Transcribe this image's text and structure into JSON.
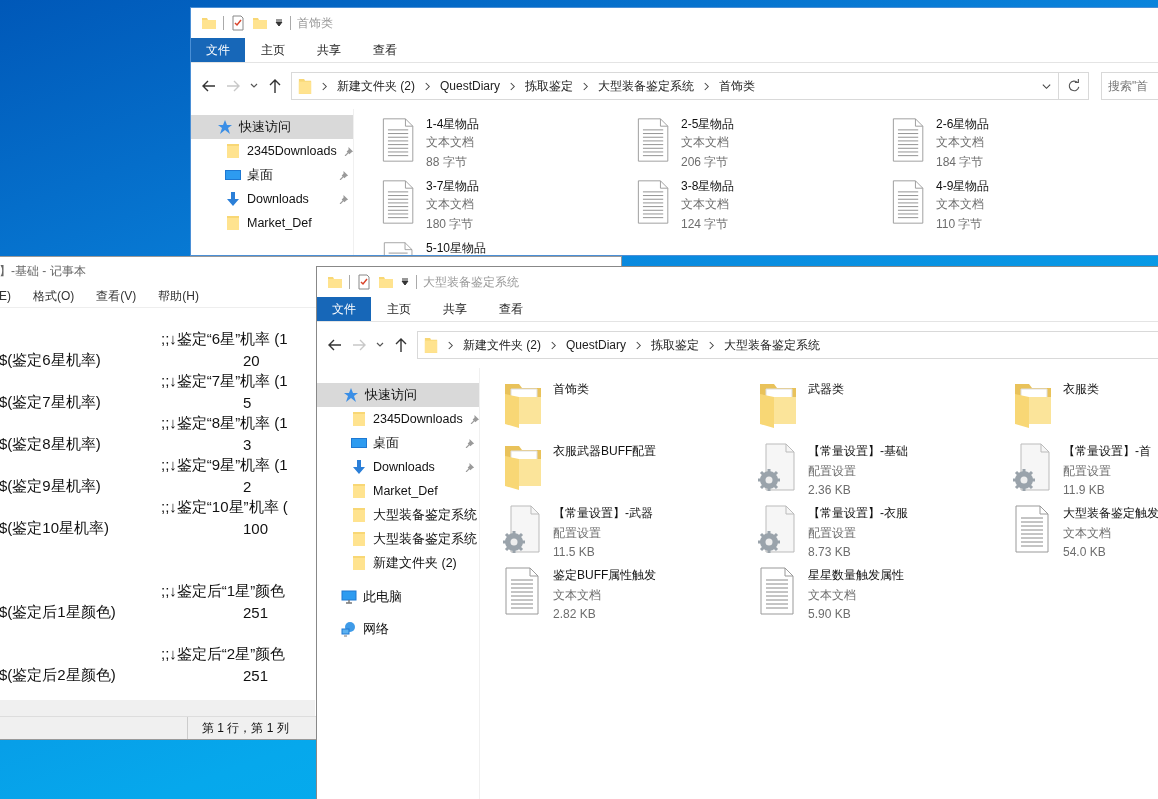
{
  "back_explorer": {
    "title": "首饰类",
    "ribbon_tabs": [
      {
        "label": "文件",
        "selected": true
      },
      {
        "label": "主页",
        "selected": false
      },
      {
        "label": "共享",
        "selected": false
      },
      {
        "label": "查看",
        "selected": false
      }
    ],
    "forward_disabled": true,
    "path": [
      "新建文件夹 (2)",
      "QuestDiary",
      "拣取鉴定",
      "大型装备鉴定系统",
      "首饰类"
    ],
    "search": {
      "placeholder": "搜索\"首"
    },
    "sidebar": [
      {
        "label": "快速访问",
        "kind": "quick",
        "selected": true,
        "pinned": false
      },
      {
        "label": "2345Downloads",
        "kind": "folder",
        "selected": false,
        "pinned": true
      },
      {
        "label": "桌面",
        "kind": "desktop",
        "selected": false,
        "pinned": true
      },
      {
        "label": "Downloads",
        "kind": "download",
        "selected": false,
        "pinned": true
      },
      {
        "label": "Market_Def",
        "kind": "folder",
        "selected": false,
        "pinned": false
      }
    ],
    "items": [
      {
        "name": "1-4星物品",
        "kind": "text",
        "type": "文本文档",
        "size": "88 字节"
      },
      {
        "name": "2-5星物品",
        "kind": "text",
        "type": "文本文档",
        "size": "206 字节"
      },
      {
        "name": "2-6星物品",
        "kind": "text",
        "type": "文本文档",
        "size": "184 字节"
      },
      {
        "name": "3-7星物品",
        "kind": "text",
        "type": "文本文档",
        "size": "180 字节"
      },
      {
        "name": "3-8星物品",
        "kind": "text",
        "type": "文本文档",
        "size": "124 字节"
      },
      {
        "name": "4-9星物品",
        "kind": "text",
        "type": "文本文档",
        "size": "110 字节"
      },
      {
        "name": "5-10星物品",
        "kind": "text"
      }
    ]
  },
  "notepad": {
    "title": "】-基础 - 记事本",
    "menu": [
      "E)",
      "格式(O)",
      "查看(V)",
      "帮助(H)"
    ],
    "lines": [
      {
        "kind": "comment",
        "text": ";;↓鉴定“6星”机率 (1"
      },
      {
        "kind": "value",
        "name": "$(鉴定6星机率)",
        "value": "20"
      },
      {
        "kind": "comment",
        "text": ";;↓鉴定“7星”机率 (1"
      },
      {
        "kind": "value",
        "name": "$(鉴定7星机率)",
        "value": "5"
      },
      {
        "kind": "comment",
        "text": ";;↓鉴定“8星”机率 (1"
      },
      {
        "kind": "value",
        "name": "$(鉴定8星机率)",
        "value": "3"
      },
      {
        "kind": "comment",
        "text": ";;↓鉴定“9星”机率 (1"
      },
      {
        "kind": "value",
        "name": "$(鉴定9星机率)",
        "value": "2"
      },
      {
        "kind": "comment",
        "text": ";;↓鉴定“10星”机率 ("
      },
      {
        "kind": "value",
        "name": "$(鉴定10星机率)",
        "value": "100"
      },
      {
        "kind": "blank"
      },
      {
        "kind": "blank"
      },
      {
        "kind": "comment",
        "text": ";;↓鉴定后“1星”颜色"
      },
      {
        "kind": "value",
        "name": "$(鉴定后1星颜色)",
        "value": "251"
      },
      {
        "kind": "blank"
      },
      {
        "kind": "comment",
        "text": ";;↓鉴定后“2星”颜色"
      },
      {
        "kind": "value",
        "name": "$(鉴定后2星颜色)",
        "value": "251"
      }
    ],
    "status": "第 1 行，第 1 列"
  },
  "front_explorer": {
    "title": "大型装备鉴定系统",
    "ribbon_tabs": [
      {
        "label": "文件",
        "selected": true
      },
      {
        "label": "主页",
        "selected": false
      },
      {
        "label": "共享",
        "selected": false
      },
      {
        "label": "查看",
        "selected": false
      }
    ],
    "forward_disabled": true,
    "path": [
      "新建文件夹 (2)",
      "QuestDiary",
      "拣取鉴定",
      "大型装备鉴定系统"
    ],
    "sidebar": [
      {
        "label": "快速访问",
        "kind": "quick",
        "selected": true,
        "pinned": false
      },
      {
        "label": "2345Downloads",
        "kind": "folder",
        "selected": false,
        "pinned": true
      },
      {
        "label": "桌面",
        "kind": "desktop",
        "selected": false,
        "pinned": true
      },
      {
        "label": "Downloads",
        "kind": "download",
        "selected": false,
        "pinned": true
      },
      {
        "label": "Market_Def",
        "kind": "folder",
        "selected": false,
        "pinned": false
      },
      {
        "label": "大型装备鉴定系统",
        "kind": "folder",
        "selected": false,
        "pinned": false
      },
      {
        "label": "大型装备鉴定系统",
        "kind": "folder",
        "selected": false,
        "pinned": false
      },
      {
        "label": "新建文件夹 (2)",
        "kind": "folder",
        "selected": false,
        "pinned": false
      },
      {
        "label": "此电脑",
        "kind": "pc",
        "selected": false,
        "pinned": false
      },
      {
        "label": "网络",
        "kind": "network",
        "selected": false,
        "pinned": false
      }
    ],
    "items": [
      {
        "name": "首饰类",
        "kind": "folder"
      },
      {
        "name": "武器类",
        "kind": "folder"
      },
      {
        "name": "衣服类",
        "kind": "folder"
      },
      {
        "name": "衣服武器BUFF配置",
        "kind": "folder"
      },
      {
        "name": "【常量设置】-基础",
        "kind": "config",
        "type": "配置设置",
        "size": "2.36 KB"
      },
      {
        "name": "【常量设置】-首",
        "kind": "config",
        "type": "配置设置",
        "size": "11.9 KB"
      },
      {
        "name": "【常量设置】-武器",
        "kind": "config",
        "type": "配置设置",
        "size": "11.5 KB"
      },
      {
        "name": "【常量设置】-衣服",
        "kind": "config",
        "type": "配置设置",
        "size": "8.73 KB"
      },
      {
        "name": "大型装备鉴定触发",
        "kind": "text",
        "type": "文本文档",
        "size": "54.0 KB"
      },
      {
        "name": "鉴定BUFF属性触发",
        "kind": "text",
        "type": "文本文档",
        "size": "2.82 KB"
      },
      {
        "name": "星星数量触发属性",
        "kind": "text",
        "type": "文本文档",
        "size": "5.90 KB"
      }
    ]
  }
}
